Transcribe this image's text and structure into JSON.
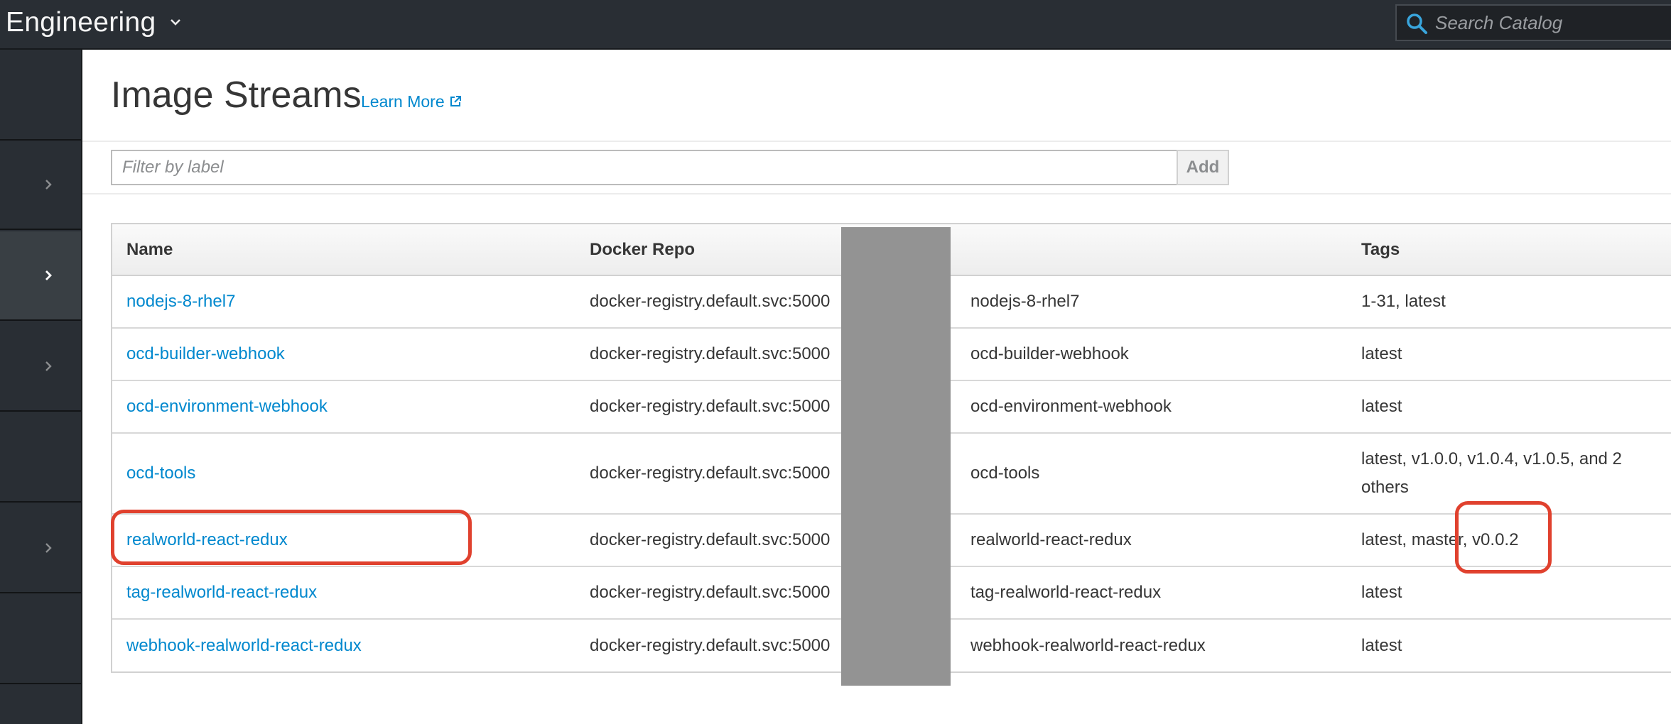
{
  "topbar": {
    "project_name": "Engineering",
    "search_placeholder": "Search Catalog"
  },
  "page": {
    "title": "Image Streams",
    "learn_more": "Learn More"
  },
  "filter": {
    "placeholder": "Filter by label",
    "add_label": "Add"
  },
  "table": {
    "headers": {
      "name": "Name",
      "docker_repo": "Docker Repo",
      "tags": "Tags"
    },
    "rows": [
      {
        "name": "nodejs-8-rhel7",
        "repo_prefix": "docker-registry.default.svc:5000",
        "repo_suffix": "nodejs-8-rhel7",
        "tags": "1-31, latest"
      },
      {
        "name": "ocd-builder-webhook",
        "repo_prefix": "docker-registry.default.svc:5000",
        "repo_suffix": "ocd-builder-webhook",
        "tags": "latest"
      },
      {
        "name": "ocd-environment-webhook",
        "repo_prefix": "docker-registry.default.svc:5000",
        "repo_suffix": "ocd-environment-webhook",
        "tags": "latest"
      },
      {
        "name": "ocd-tools",
        "repo_prefix": "docker-registry.default.svc:5000",
        "repo_suffix": "ocd-tools",
        "tags": "latest, v1.0.0, v1.0.4, v1.0.5, and 2 others"
      },
      {
        "name": "realworld-react-redux",
        "repo_prefix": "docker-registry.default.svc:5000",
        "repo_suffix": "realworld-react-redux",
        "tags": "latest, master, v0.0.2"
      },
      {
        "name": "tag-realworld-react-redux",
        "repo_prefix": "docker-registry.default.svc:5000",
        "repo_suffix": "tag-realworld-react-redux",
        "tags": "latest"
      },
      {
        "name": "webhook-realworld-react-redux",
        "repo_prefix": "docker-registry.default.svc:5000",
        "repo_suffix": "webhook-realworld-react-redux",
        "tags": "latest"
      }
    ]
  },
  "icons": {
    "search": "search-icon",
    "project_dropdown": "chevron-down-icon",
    "nav_expand": "chevron-right-icon",
    "external_link": "external-link-icon"
  },
  "colors": {
    "masthead": "#292e34",
    "link": "#0088ce",
    "annotation": "#e0412e",
    "redaction": "#939393"
  }
}
